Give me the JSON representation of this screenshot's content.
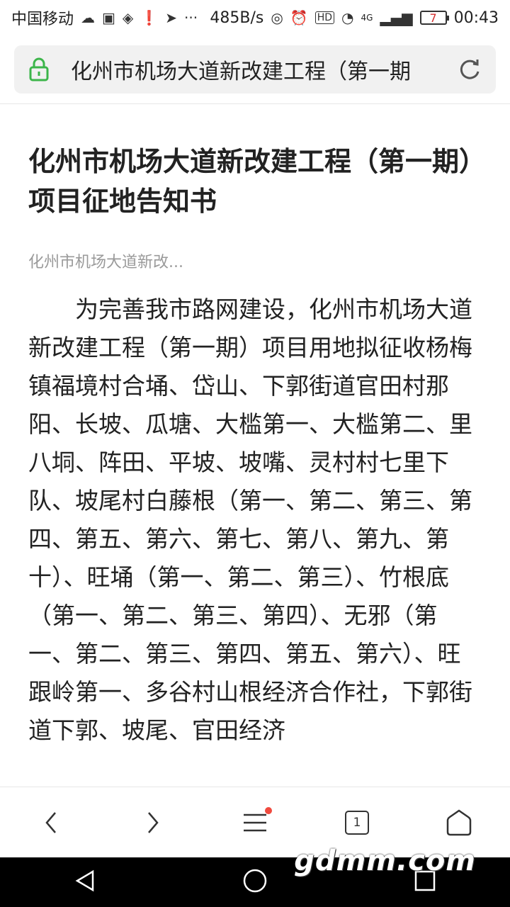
{
  "statusbar": {
    "carrier": "中国移动",
    "net_speed": "485B/s",
    "network": "4G",
    "battery": "7",
    "time": "00:43"
  },
  "addressbar": {
    "text": "化州市机场大道新改建工程（第一期"
  },
  "article": {
    "title": "化州市机场大道新改建工程（第一期）项目征地告知书",
    "subtitle": "化州市机场大道新改...",
    "body": "为完善我市路网建设，化州市机场大道新改建工程（第一期）项目用地拟征收杨梅镇福境村合埇、岱山、下郭街道官田村那阳、长坡、瓜塘、大槛第一、大槛第二、里八垌、阵田、平坡、坡嘴、灵村村七里下队、坡尾村白藤根（第一、第二、第三、第四、第五、第六、第七、第八、第九、第十）、旺埇（第一、第二、第三）、竹根底（第一、第二、第三、第四）、无邪（第一、第二、第三、第四、第五、第六）、旺跟岭第一、多谷村山根经济合作社，下郭街道下郭、坡尾、官田经济"
  },
  "bottomnav": {
    "tab_count": "1"
  },
  "watermark": "gdmm.com"
}
